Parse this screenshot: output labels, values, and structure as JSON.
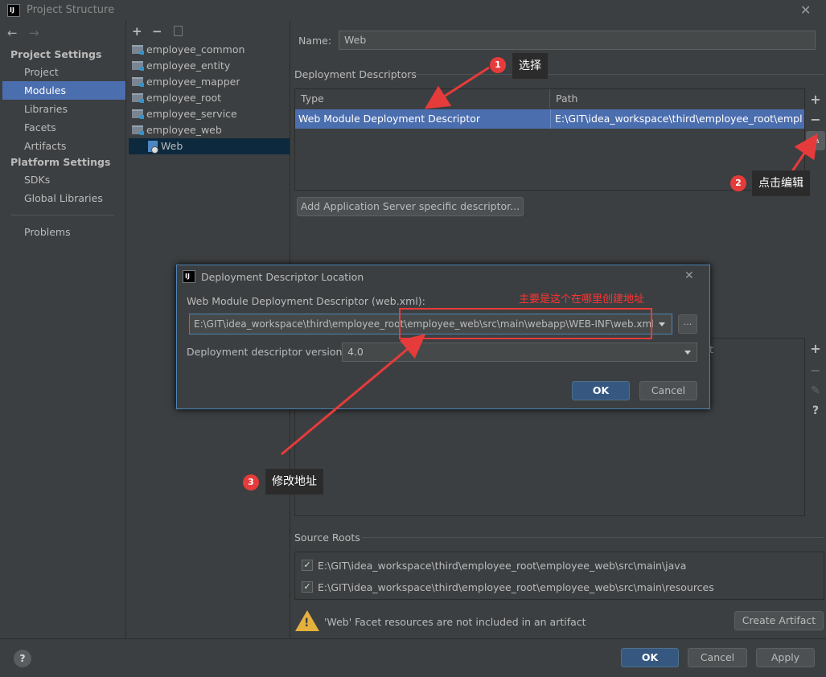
{
  "window": {
    "title": "Project Structure",
    "icon_text": "IJ"
  },
  "left_nav": {
    "project_settings_header": "Project Settings",
    "project_items": [
      "Project",
      "Modules",
      "Libraries",
      "Facets",
      "Artifacts"
    ],
    "platform_settings_header": "Platform Settings",
    "platform_items": [
      "SDKs",
      "Global Libraries"
    ],
    "problems": "Problems",
    "selected": "Modules"
  },
  "module_tree": {
    "items": [
      "employee_common",
      "employee_entity",
      "employee_mapper",
      "employee_root",
      "employee_service",
      "employee_web"
    ],
    "child": "Web"
  },
  "facet": {
    "name_label": "Name:",
    "name_value": "Web",
    "deployment_descriptors_title": "Deployment Descriptors",
    "col_type": "Type",
    "col_path": "Path",
    "row_type": "Web Module Deployment Descriptor",
    "row_path": "E:\\GIT\\idea_workspace\\third\\employee_root\\employee",
    "add_server_button": "Add Application Server specific descriptor...",
    "second_table_col": "t",
    "source_roots_title": "Source Roots",
    "source_roots": [
      "E:\\GIT\\idea_workspace\\third\\employee_root\\employee_web\\src\\main\\java",
      "E:\\GIT\\idea_workspace\\third\\employee_root\\employee_web\\src\\main\\resources"
    ],
    "warning_text": "'Web' Facet resources are not included in an artifact",
    "create_artifact_button": "Create Artifact"
  },
  "dialog": {
    "title": "Deployment Descriptor Location",
    "icon_text": "IJ",
    "descriptor_label": "Web Module Deployment Descriptor (web.xml):",
    "descriptor_path": "E:\\GIT\\idea_workspace\\third\\employee_root\\employee_web\\src\\main\\webapp\\WEB-INF\\web.xml",
    "browse_label": "...",
    "version_label": "Deployment descriptor version",
    "version_value": "4.0",
    "ok": "OK",
    "cancel": "Cancel"
  },
  "annotations": {
    "step1_number": "1",
    "step1_text": "选择",
    "step2_number": "2",
    "step2_text": "点击编辑",
    "step3_number": "3",
    "step3_text": "修改地址",
    "note": "主要是这个在哪里创建地址",
    "accent_red": "#e63b3b"
  },
  "footer": {
    "help": "?",
    "ok": "OK",
    "cancel": "Cancel",
    "apply": "Apply"
  }
}
